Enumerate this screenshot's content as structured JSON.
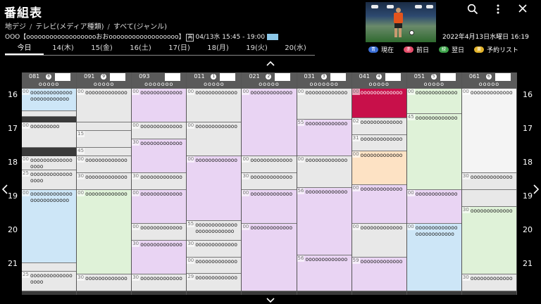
{
  "header": {
    "title": "番組表",
    "breadcrumb": [
      "地デジ",
      "テレビ(メディア種類)",
      "すべて(ジャンル)"
    ],
    "program_line": "ООО【ooooooooooooooooooおおoooooooooooooooooo】",
    "program_tag": "再",
    "program_time": "04/13水 15:45 - 19:00",
    "datetime": "2022年4月13日水曜日 16:19"
  },
  "day_tabs": [
    {
      "label": "今日",
      "active": true
    },
    {
      "label": "14(木)",
      "active": false
    },
    {
      "label": "15(金)",
      "active": false
    },
    {
      "label": "16(土)",
      "active": false
    },
    {
      "label": "17(日)",
      "active": false
    },
    {
      "label": "18(月)",
      "active": false
    },
    {
      "label": "19(火)",
      "active": false
    },
    {
      "label": "20(水)",
      "active": false
    }
  ],
  "legend": [
    {
      "key": "青",
      "label": "現在",
      "color": "#3b6fd6"
    },
    {
      "key": "赤",
      "label": "前日",
      "color": "#e64d6a"
    },
    {
      "key": "緑",
      "label": "翌日",
      "color": "#3da34a"
    },
    {
      "key": "黄",
      "label": "予約リスト",
      "color": "#e3b32a"
    }
  ],
  "icons": {
    "search": "search-icon",
    "menu": "more-vertical-icon",
    "close": "close-icon",
    "up": "chevron-up-icon",
    "down": "chevron-down-icon",
    "left": "chevron-left-icon",
    "right": "chevron-right-icon"
  },
  "hours": [
    "16",
    "17",
    "18",
    "19",
    "20",
    "21"
  ],
  "channels": [
    {
      "num": "081",
      "badge": "8",
      "name": "ооооо",
      "programs": [
        {
          "start": 0,
          "dur": 50,
          "min": "00",
          "title": "ооооооооооооооооооооооооо",
          "color": "gray"
        },
        {
          "start": 0.4,
          "dur": 40,
          "min": "00",
          "title": "ооооооооооооооооооооооооо",
          "color": "blue"
        },
        {
          "start": 60,
          "dur": 45,
          "min": "00",
          "title": "ооооооооо",
          "color": "gray"
        },
        {
          "start": 120,
          "dur": 25,
          "min": "00",
          "title": "ооооооооооооооооо",
          "color": "gray"
        },
        {
          "start": 145,
          "dur": 35,
          "min": "25",
          "title": "ооооооооооооооооо",
          "color": "gray"
        },
        {
          "start": 180,
          "dur": 130,
          "min": "00",
          "title": "ооооооооооооооооооооооооо",
          "color": "blue"
        },
        {
          "start": 310,
          "dur": 15,
          "min": "",
          "title": "",
          "color": "gray"
        },
        {
          "start": 325,
          "dur": 35,
          "min": "25",
          "title": "ооооооооооооооооо",
          "color": "gray"
        }
      ]
    },
    {
      "num": "091",
      "badge": "9",
      "name": "ооооо",
      "programs": [
        {
          "start": 0,
          "dur": 60,
          "min": "00",
          "title": "ооооооооооооо",
          "color": "gray"
        },
        {
          "start": 60,
          "dur": 15,
          "min": "",
          "title": "",
          "color": "gray"
        },
        {
          "start": 75,
          "dur": 30,
          "min": "15",
          "title": "",
          "color": "gray"
        },
        {
          "start": 105,
          "dur": 15,
          "min": "45",
          "title": "",
          "color": "gray"
        },
        {
          "start": 120,
          "dur": 30,
          "min": "00",
          "title": "ооооооооооооо",
          "color": "gray"
        },
        {
          "start": 150,
          "dur": 30,
          "min": "30",
          "title": "ооооооооооооо",
          "color": "gray"
        },
        {
          "start": 180,
          "dur": 150,
          "min": "00",
          "title": "ооооооооооооо",
          "color": "green"
        },
        {
          "start": 330,
          "dur": 30,
          "min": "30",
          "title": "ооооооооооооо",
          "color": "gray"
        }
      ]
    },
    {
      "num": "093",
      "badge": "",
      "name": "ооооооо",
      "programs": [
        {
          "start": 0,
          "dur": 60,
          "min": "00",
          "title": "ооооооооооооо",
          "color": "purple"
        },
        {
          "start": 60,
          "dur": 30,
          "min": "00",
          "title": "ооооооооооооо",
          "color": "gray"
        },
        {
          "start": 90,
          "dur": 60,
          "min": "30",
          "title": "ооооооооооооо",
          "color": "purple"
        },
        {
          "start": 150,
          "dur": 30,
          "min": "30",
          "title": "ооооооооооооо",
          "color": "gray"
        },
        {
          "start": 180,
          "dur": 60,
          "min": "00",
          "title": "ооооооооооооо",
          "color": "purple"
        },
        {
          "start": 240,
          "dur": 30,
          "min": "00",
          "title": "ооооооооооооо",
          "color": "gray"
        },
        {
          "start": 270,
          "dur": 60,
          "min": "30",
          "title": "ооооооооооооо",
          "color": "purple"
        },
        {
          "start": 330,
          "dur": 30,
          "min": "30",
          "title": "ооооооооооооо",
          "color": "gray"
        }
      ]
    },
    {
      "num": "011",
      "badge": "1",
      "name": "ооооо",
      "programs": [
        {
          "start": 0,
          "dur": 60,
          "min": "00",
          "title": "ооооооооооооо",
          "color": "gray"
        },
        {
          "start": 60,
          "dur": 60,
          "min": "00",
          "title": "ооооооооооооо",
          "color": "gray"
        },
        {
          "start": 120,
          "dur": 115,
          "min": "00",
          "title": "ооооооооооооо",
          "color": "purple"
        },
        {
          "start": 235,
          "dur": 35,
          "min": "55",
          "title": "ооооооооооооооооооооооооо",
          "color": "gray"
        },
        {
          "start": 270,
          "dur": 30,
          "min": "30",
          "title": "ооооооооооооо",
          "color": "gray"
        },
        {
          "start": 300,
          "dur": 29,
          "min": "00",
          "title": "ооооооооооооо",
          "color": "gray"
        },
        {
          "start": 329,
          "dur": 31,
          "min": "29",
          "title": "ооооооооооооо",
          "color": "gray"
        }
      ]
    },
    {
      "num": "021",
      "badge": "2",
      "name": "ооооо",
      "programs": [
        {
          "start": 0,
          "dur": 120,
          "min": "00",
          "title": "ооооооооооооо",
          "color": "purple"
        },
        {
          "start": 120,
          "dur": 30,
          "min": "00",
          "title": "ооооооооооооо",
          "color": "gray"
        },
        {
          "start": 150,
          "dur": 30,
          "min": "30",
          "title": "ооооооооооооо",
          "color": "gray"
        },
        {
          "start": 180,
          "dur": 60,
          "min": "00",
          "title": "ооооооооооооо",
          "color": "purple"
        },
        {
          "start": 240,
          "dur": 120,
          "min": "00",
          "title": "ооооооооооооо",
          "color": "purple"
        }
      ]
    },
    {
      "num": "031",
      "badge": "3",
      "name": "ооооооо",
      "programs": [
        {
          "start": 0,
          "dur": 55,
          "min": "00",
          "title": "ооооооооооооо",
          "color": "gray"
        },
        {
          "start": 55,
          "dur": 65,
          "min": "55",
          "title": "ооооооооооооо",
          "color": "purple"
        },
        {
          "start": 120,
          "dur": 56,
          "min": "00",
          "title": "ооооооооооооо",
          "color": "gray"
        },
        {
          "start": 176,
          "dur": 120,
          "min": "56",
          "title": "ооооооооооооо",
          "color": "purple"
        },
        {
          "start": 296,
          "dur": 64,
          "min": "56",
          "title": "ооооооооооооо",
          "color": "purple"
        }
      ]
    },
    {
      "num": "041",
      "badge": "4",
      "name": "ооооо",
      "programs": [
        {
          "start": 0,
          "dur": 52,
          "min": "00",
          "title": "ооооооооооооо",
          "color": "red"
        },
        {
          "start": 52,
          "dur": 30,
          "min": "02",
          "title": "ооооооооооооо",
          "color": "gray"
        },
        {
          "start": 82,
          "dur": 29,
          "min": "31",
          "title": "ооооооооооооо",
          "color": "gray"
        },
        {
          "start": 111,
          "dur": 60,
          "min": "00",
          "title": "ооооооооооооо",
          "color": "orange"
        },
        {
          "start": 171,
          "dur": 69,
          "min": "00",
          "title": "ооооооооооооо",
          "color": "purple"
        },
        {
          "start": 240,
          "dur": 60,
          "min": "00",
          "title": "ооооооооооооо",
          "color": "gray"
        },
        {
          "start": 300,
          "dur": 60,
          "min": "59",
          "title": "ооооооооооооо",
          "color": "purple"
        }
      ]
    },
    {
      "num": "051",
      "badge": "5",
      "name": "ооооо",
      "programs": [
        {
          "start": 0,
          "dur": 45,
          "min": "00",
          "title": "ооооооооооооо",
          "color": "green"
        },
        {
          "start": 45,
          "dur": 135,
          "min": "45",
          "title": "ооооооооооооо",
          "color": "green"
        },
        {
          "start": 180,
          "dur": 60,
          "min": "00",
          "title": "ооооооооооооо",
          "color": "purple"
        },
        {
          "start": 240,
          "dur": 120,
          "min": "00",
          "title": "ооооооооооооооооооооооооо",
          "color": "blue"
        }
      ]
    },
    {
      "num": "061",
      "badge": "6",
      "name": "ооооо",
      "programs": [
        {
          "start": 0,
          "dur": 150,
          "min": "00",
          "title": "ооооооооооооо",
          "color": "white"
        },
        {
          "start": 150,
          "dur": 30,
          "min": "30",
          "title": "ооооооооооооо",
          "color": "gray"
        },
        {
          "start": 180,
          "dur": 30,
          "min": "",
          "title": "",
          "color": "gray"
        },
        {
          "start": 210,
          "dur": 120,
          "min": "30",
          "title": "ооооооооооооо",
          "color": "green"
        },
        {
          "start": 330,
          "dur": 30,
          "min": "30",
          "title": "ооооооооооооо",
          "color": "gray"
        }
      ]
    }
  ]
}
